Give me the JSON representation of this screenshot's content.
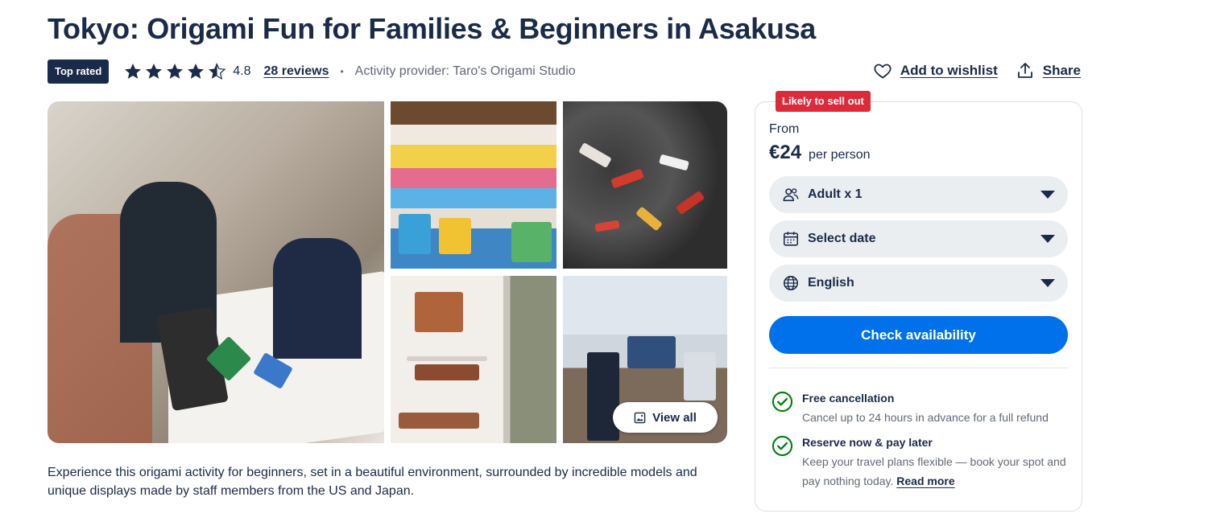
{
  "header": {
    "title": "Tokyo: Origami Fun for Families & Beginners in Asakusa",
    "badge": "Top rated",
    "rating": "4.8",
    "rating_value": 4.8,
    "reviews": "28 reviews",
    "separator": "•",
    "provider": "Activity provider: Taro's Origami Studio",
    "wishlist_label": "Add to wishlist",
    "share_label": "Share"
  },
  "gallery": {
    "photos": [
      {
        "icon": "photo-family-origami"
      },
      {
        "icon": "photo-origami-paper-shelf"
      },
      {
        "icon": "photo-koi-origami-wall"
      },
      {
        "icon": "photo-origami-animals-shelf"
      },
      {
        "icon": "photo-studio-interior"
      }
    ],
    "view_all_label": "View all"
  },
  "description": "Experience this origami activity for beginners, set in a beautiful environment, surrounded by incredible models and unique displays made by staff members from the US and Japan.",
  "booking": {
    "sell_badge": "Likely to sell out",
    "from_label": "From",
    "price": "€24",
    "per_label": "per person",
    "participants": "Adult x 1",
    "date": "Select date",
    "language": "English",
    "cta": "Check availability",
    "features": [
      {
        "title": "Free cancellation",
        "text": "Cancel up to 24 hours in advance for a full refund"
      },
      {
        "title": "Reserve now & pay later",
        "text": "Keep your travel plans flexible — book your spot and pay nothing today.",
        "link": "Read more"
      }
    ]
  },
  "colors": {
    "navy": "#1a2b49",
    "primary": "#0071eb",
    "sell_badge": "#dc2a3b",
    "check_green": "#008009",
    "select_bg": "#ebeef1"
  }
}
